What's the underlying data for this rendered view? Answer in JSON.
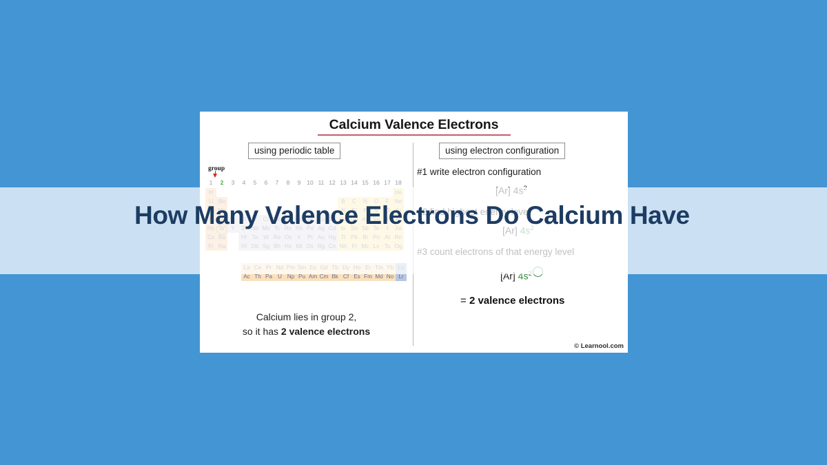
{
  "page": {
    "background_color": "#4495d4",
    "headline": "How Many Valence Electrons Do Calcium Have",
    "headline_color": "#1d3c63",
    "banner_color": "rgba(255,255,255,0.72)"
  },
  "card": {
    "title": "Calcium Valence Electrons",
    "title_rule_color": "#c75d66",
    "watermark": "© Learnool.com",
    "left": {
      "box_header": "using periodic table",
      "group_label": "group",
      "highlight_group": "2",
      "highlighted_element": "Ca",
      "caption_line1": "Calcium lies in group 2,",
      "caption_line2_prefix": "so it has ",
      "caption_line2_bold": "2 valence electrons"
    },
    "right": {
      "box_header": "using electron configuration",
      "step1": "#1 write electron configuration",
      "formula1_core": "[Ar] 4s",
      "formula1_sup": "2",
      "step2": "#2 find highest energy level",
      "formula2_core": "[Ar] ",
      "formula2_green": "4s",
      "formula2_sup": "2",
      "step3": "#3 count electrons of that energy level",
      "formula3_core": "[Ar] ",
      "formula3_green": "4s",
      "formula3_sup": "2",
      "answer_prefix": "= ",
      "answer_bold": "2 valence electrons",
      "accent_green": "#2e8b3d"
    }
  },
  "periodic_table": {
    "group_numbers": [
      "1",
      "2",
      "3",
      "4",
      "5",
      "6",
      "7",
      "8",
      "9",
      "10",
      "11",
      "12",
      "13",
      "14",
      "15",
      "16",
      "17",
      "18"
    ],
    "rows": [
      [
        "H",
        "",
        "",
        "",
        "",
        "",
        "",
        "",
        "",
        "",
        "",
        "",
        "",
        "",
        "",
        "",
        "",
        "He"
      ],
      [
        "Li",
        "Be",
        "",
        "",
        "",
        "",
        "",
        "",
        "",
        "",
        "",
        "",
        "B",
        "C",
        "N",
        "O",
        "F",
        "Ne"
      ],
      [
        "Na",
        "Mg",
        "",
        "",
        "",
        "",
        "",
        "",
        "",
        "",
        "",
        "",
        "Al",
        "Si",
        "P",
        "S",
        "Cl",
        "Ar"
      ],
      [
        "K",
        "Ca",
        "Sc",
        "Ti",
        "V",
        "Cr",
        "Mn",
        "Fe",
        "Co",
        "Ni",
        "Cu",
        "Zn",
        "Ga",
        "Ge",
        "As",
        "Se",
        "Br",
        "Kr"
      ],
      [
        "Rb",
        "Sr",
        "Y",
        "Zr",
        "Nb",
        "Mo",
        "Tc",
        "Ru",
        "Rh",
        "Pd",
        "Ag",
        "Cd",
        "In",
        "Sn",
        "Sb",
        "Te",
        "I",
        "Xe"
      ],
      [
        "Cs",
        "Ba",
        "",
        "Hf",
        "Ta",
        "W",
        "Re",
        "Os",
        "Ir",
        "Pt",
        "Au",
        "Hg",
        "Tl",
        "Pb",
        "Bi",
        "Po",
        "At",
        "Rn"
      ],
      [
        "Fr",
        "Ra",
        "",
        "Rf",
        "Db",
        "Sg",
        "Bh",
        "Hs",
        "Mt",
        "Ds",
        "Rg",
        "Cn",
        "Nh",
        "Fl",
        "Mc",
        "Lv",
        "Ts",
        "Og"
      ]
    ],
    "lanthanides": [
      "La",
      "Ce",
      "Pr",
      "Nd",
      "Pm",
      "Sm",
      "Eu",
      "Gd",
      "Tb",
      "Dy",
      "Ho",
      "Er",
      "Tm",
      "Yb",
      "Lu"
    ],
    "actinides": [
      "Ac",
      "Th",
      "Pa",
      "U",
      "Np",
      "Pu",
      "Am",
      "Cm",
      "Bk",
      "Cf",
      "Es",
      "Fm",
      "Md",
      "No",
      "Lr"
    ],
    "colors": {
      "s_block": "#f6c9a0",
      "d_block": "#d9d9e6",
      "p_block": "#fbe9a6",
      "f_block": "#fae1bd",
      "lu_lr": "#b6c7e2",
      "panel_background": "#fdeef3",
      "circle_highlight": "#7cb87c"
    }
  }
}
